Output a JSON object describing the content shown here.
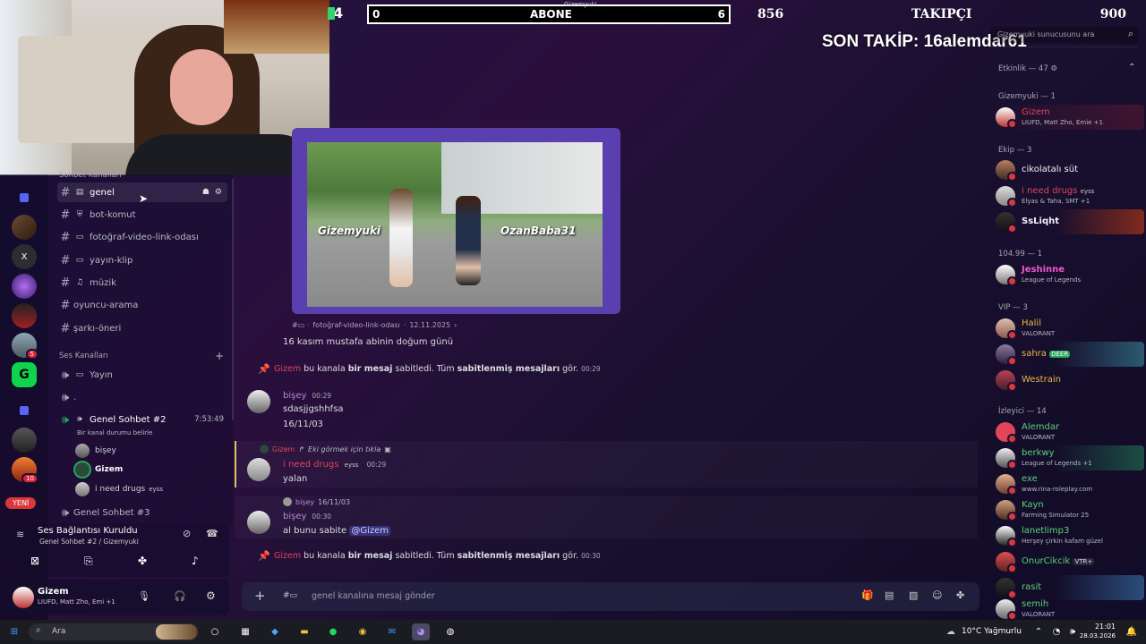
{
  "overlay": {
    "abone_left": "0",
    "abone_label": "ABONE",
    "abone_right": "6",
    "abone_small": "Gizemyuki",
    "takip_left": "856",
    "takip_label": "TAKIPÇI",
    "takip_right": "900",
    "rank": "4",
    "son_takip": "SON TAKİP: 16alemdar61"
  },
  "search": {
    "placeholder": "Gizemyuki sunucusunu ara"
  },
  "activity": {
    "label": "Etkinlik — 47"
  },
  "channels": {
    "category_text": "Sohbet Kanalları",
    "text": [
      {
        "name": "genel",
        "icon": "message-icon"
      },
      {
        "name": "bot-komut",
        "icon": "shield-icon"
      },
      {
        "name": "fotoğraf-video-link-odası",
        "icon": "camera-icon"
      },
      {
        "name": "yayın-klip",
        "icon": "camera-icon"
      },
      {
        "name": "müzik",
        "icon": "music-icon"
      },
      {
        "name": "oyuncu-arama",
        "icon": ""
      },
      {
        "name": "şarkı-öneri",
        "icon": ""
      }
    ],
    "voice_category": "Ses Kanalları",
    "voice": [
      {
        "name": "Yayın"
      },
      {
        "name": "."
      },
      {
        "name": "Genel Sohbet #2",
        "time": "7:53:49",
        "status": "Bir kanal durumu belirle"
      }
    ],
    "voice_users": [
      {
        "name": "bişey"
      },
      {
        "name": "Gizem"
      },
      {
        "name": "i need drugs",
        "tag": "eyss"
      }
    ],
    "next_voice": "Genel Sohbet #3"
  },
  "connection": {
    "title": "Ses Bağlantısı Kuruldu",
    "subtitle": "Genel Sohbet #2 / Gizemyuki"
  },
  "user_panel": {
    "name": "Gizem",
    "activity": "LIUFD, Matt Zho, Emi +1"
  },
  "rail": {
    "yeni": "YENİ",
    "badge_a": "5",
    "badge_b": "10",
    "x_label": "X"
  },
  "post": {
    "caption_left": "Gizemyuki",
    "caption_right": "OzanBaba31",
    "channel": "fotoğraf-video-link-odası",
    "date": "12.11.2025",
    "text": "16 kasım mustafa abinin doğum günü"
  },
  "messages": {
    "sys1": {
      "user": "Gizem",
      "a": "bu kanala",
      "b": "bir mesaj",
      "c": "sabitledi. Tüm",
      "d": "sabitlenmiş mesajları",
      "e": "gör.",
      "time": "00:29"
    },
    "m1": {
      "user": "bişey",
      "time": "00:29",
      "line1": "sdasjjgshhfsa",
      "line2": "16/11/03"
    },
    "m2": {
      "reply_user": "Gizem",
      "reply_text": "Eki görmek için tıkla",
      "user": "i need drugs",
      "tag": "eyss",
      "time": "00:29",
      "text": "yalan"
    },
    "m3": {
      "reply_user": "bişey",
      "reply_text": "16/11/03",
      "user": "bişey",
      "time": "00:30",
      "text": "al bunu sabite",
      "mention": "@Gizem"
    },
    "sys2": {
      "user": "Gizem",
      "a": "bu kanala",
      "b": "bir mesaj",
      "c": "sabitledi. Tüm",
      "d": "sabitlenmiş mesajları",
      "e": "gör.",
      "time": "00:30"
    }
  },
  "composer": {
    "placeholder": "genel kanalına mesaj gönder"
  },
  "members": {
    "groups": [
      {
        "label": "Gizemyuki — 1"
      },
      {
        "label": "Ekip — 3"
      },
      {
        "label": "104.99 — 1"
      },
      {
        "label": "VIP — 3"
      },
      {
        "label": "İzleyici — 14"
      }
    ],
    "list": [
      {
        "name": "Gizem",
        "activity": "LIUFD, Matt Zho, Emie +1",
        "color": "#e0455a"
      },
      {
        "name": "cikolatalı süt",
        "activity": "",
        "color": "#f2f3f5"
      },
      {
        "name": "i need drugs",
        "tag": "eyss",
        "activity": "Elyas & Taha, SMT +1",
        "color": "#e0455a"
      },
      {
        "name": "SsLiqht",
        "activity": "",
        "color": "#f2f3f5"
      },
      {
        "name": "Jeshinne",
        "activity": "League of Legends",
        "color": "#ee59c8"
      },
      {
        "name": "Halil",
        "activity": "VALORANT",
        "color": "#e8b84b"
      },
      {
        "name": "sahra",
        "tag": "DEER",
        "activity": "",
        "color": "#e8b84b"
      },
      {
        "name": "Westrain",
        "activity": "",
        "color": "#e8b84b"
      },
      {
        "name": "Alemdar",
        "activity": "VALORANT",
        "color": "#57d178"
      },
      {
        "name": "berkwy",
        "activity": "League of Legends +1",
        "color": "#57d178"
      },
      {
        "name": "exe",
        "activity": "www.rina-roleplay.com",
        "color": "#57d178"
      },
      {
        "name": "Kayn",
        "activity": "Farming Simulator 25",
        "color": "#57d178"
      },
      {
        "name": "lanetlimp3",
        "activity": "Herşey çirkin kafam güzel",
        "color": "#57d178"
      },
      {
        "name": "OnurCikcik",
        "tag": "VTR+",
        "activity": "",
        "color": "#57d178"
      },
      {
        "name": "rasit",
        "activity": "",
        "color": "#57d178"
      },
      {
        "name": "semih",
        "activity": "VALORANT",
        "color": "#57d178"
      }
    ]
  },
  "taskbar": {
    "search": "Ara",
    "weather": "10°C  Yağmurlu",
    "time": "21:01",
    "date": "28.03.2026"
  }
}
